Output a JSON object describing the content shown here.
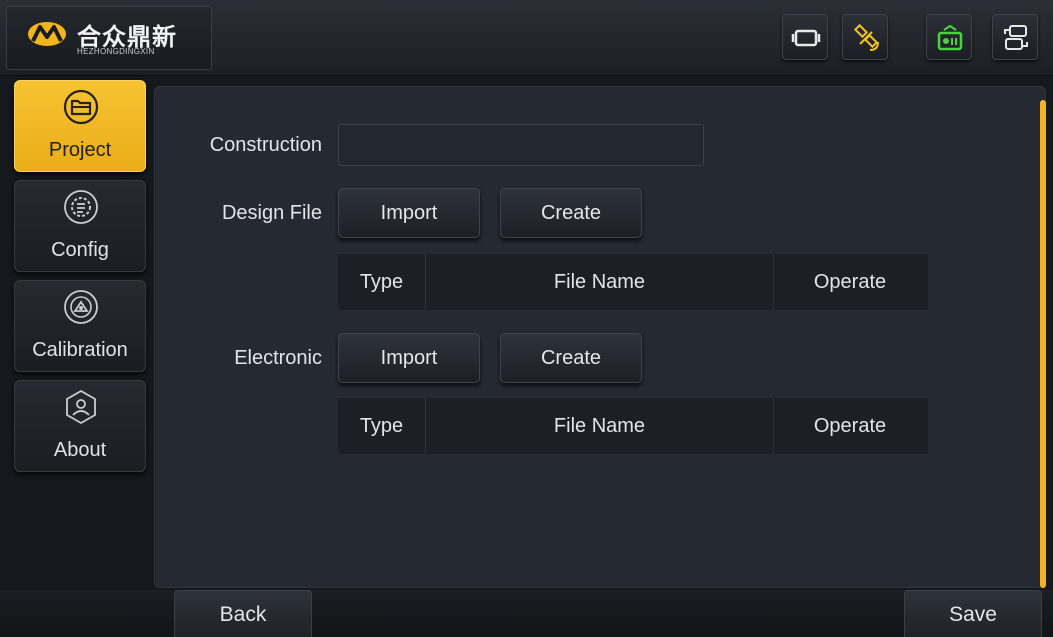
{
  "header": {
    "logo_cn": "合众鼎新",
    "logo_en": "HEZHONGDINGXIN",
    "icons": [
      "screen-icon",
      "satellite-icon",
      "radio-icon",
      "switch-icon"
    ]
  },
  "sidebar": {
    "items": [
      {
        "label": "Project",
        "icon": "folder-icon",
        "active": true
      },
      {
        "label": "Config",
        "icon": "gear-icon",
        "active": false
      },
      {
        "label": "Calibration",
        "icon": "calibration-icon",
        "active": false
      },
      {
        "label": "About",
        "icon": "about-icon",
        "active": false
      }
    ]
  },
  "form": {
    "construction_label": "Construction",
    "construction_value": "",
    "design_file_label": "Design File",
    "electronic_label": "Electronic",
    "import_label": "Import",
    "create_label": "Create"
  },
  "table": {
    "columns": [
      "Type",
      "File Name",
      "Operate"
    ]
  },
  "footer": {
    "back_label": "Back",
    "save_label": "Save"
  },
  "colors": {
    "accent": "#f2b424",
    "active_tab": "#f5bd2a",
    "panel": "#252932",
    "radio_icon": "#49d23e"
  }
}
